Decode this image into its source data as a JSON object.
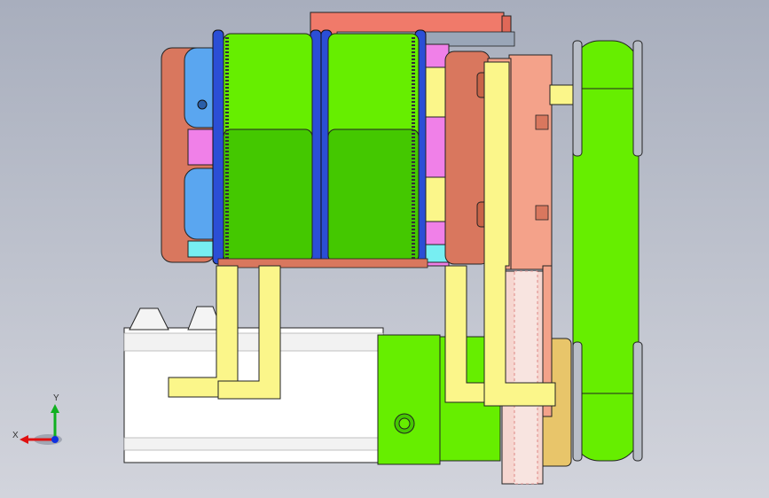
{
  "viewport": {
    "background_top": "#a8aebd",
    "background_bottom": "#d2d4dc"
  },
  "parts": {
    "roller_a": "green-roller",
    "roller_b": "green-roller",
    "belt_arm": "green-belt-arm",
    "motor": "white-motor",
    "gearbox": "green-gearbox",
    "bracket": "yellow-bracket",
    "plate_salmon": "salmon-plate",
    "plate_brown": "brown-plate",
    "spool": "blue-spool"
  },
  "colors": {
    "green": "#66ee00",
    "green_dark": "#44c800",
    "salmon": "#f4a28a",
    "brown": "#d9775e",
    "yellow": "#fbf68a",
    "blue": "#5aa6f0",
    "magenta": "#f080e8",
    "cyan": "#77eef2",
    "tan": "#e8c56a",
    "white": "#ffffff",
    "red_top": "#f07a6a"
  },
  "triad": {
    "x_label": "X",
    "y_label": "Y",
    "x_color": "#e01010",
    "y_color": "#10b020",
    "z_color": "#1030e0"
  }
}
